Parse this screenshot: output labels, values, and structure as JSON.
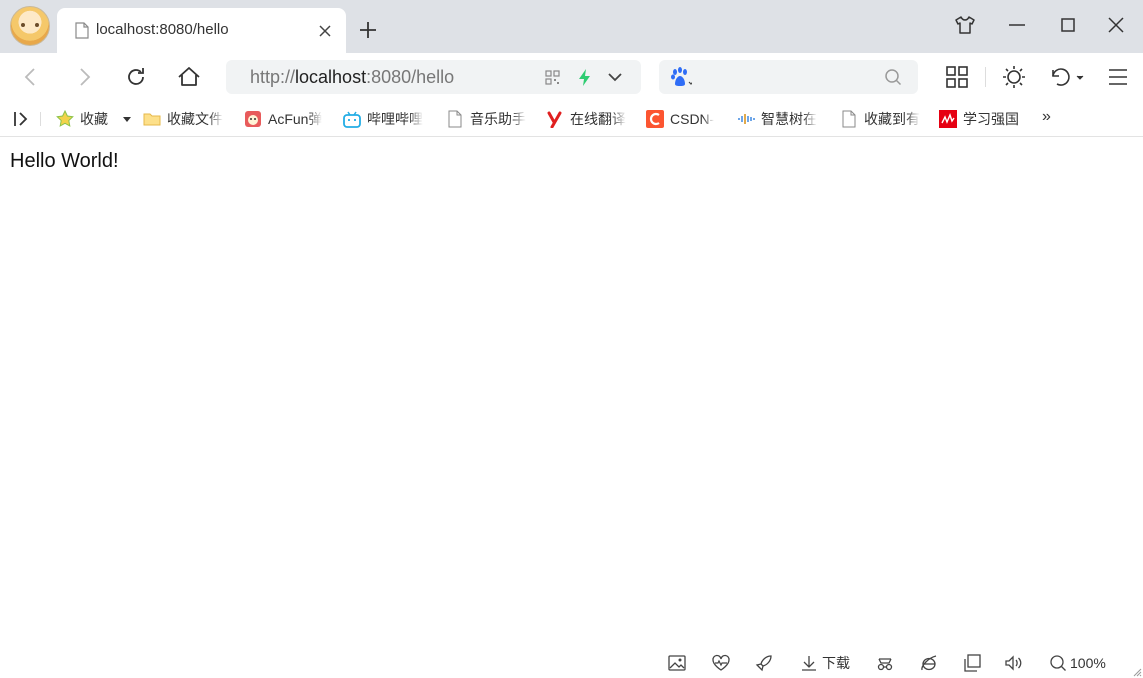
{
  "tab": {
    "title": "localhost:8080/hello"
  },
  "address_bar": {
    "url_prefix": "http://",
    "url_host": "localhost",
    "url_rest": ":8080/hello"
  },
  "search": {
    "placeholder": ""
  },
  "bookmarks": [
    {
      "label": "收藏",
      "icon": "star-icon"
    },
    {
      "label": "收藏文件",
      "icon": "folder-icon"
    },
    {
      "label": "AcFun弹",
      "icon": "acfun-icon"
    },
    {
      "label": "哔哩哔哩",
      "icon": "bilibili-icon"
    },
    {
      "label": "音乐助手",
      "icon": "page-icon"
    },
    {
      "label": "在线翻译",
      "icon": "youdao-icon"
    },
    {
      "label": "CSDN-",
      "icon": "csdn-icon"
    },
    {
      "label": "智慧树在",
      "icon": "zhihuishu-icon"
    },
    {
      "label": "收藏到有",
      "icon": "page-icon"
    },
    {
      "label": "学习强国",
      "icon": "xuexi-icon"
    }
  ],
  "bookmarks_overflow": "»",
  "page": {
    "text": "Hello World!"
  },
  "statusbar": {
    "download_label": "下载",
    "zoom": "100%"
  },
  "colors": {
    "tabstrip": "#dee1e6",
    "accent_green": "#2ecc71",
    "baidu_blue": "#2f6df6"
  }
}
